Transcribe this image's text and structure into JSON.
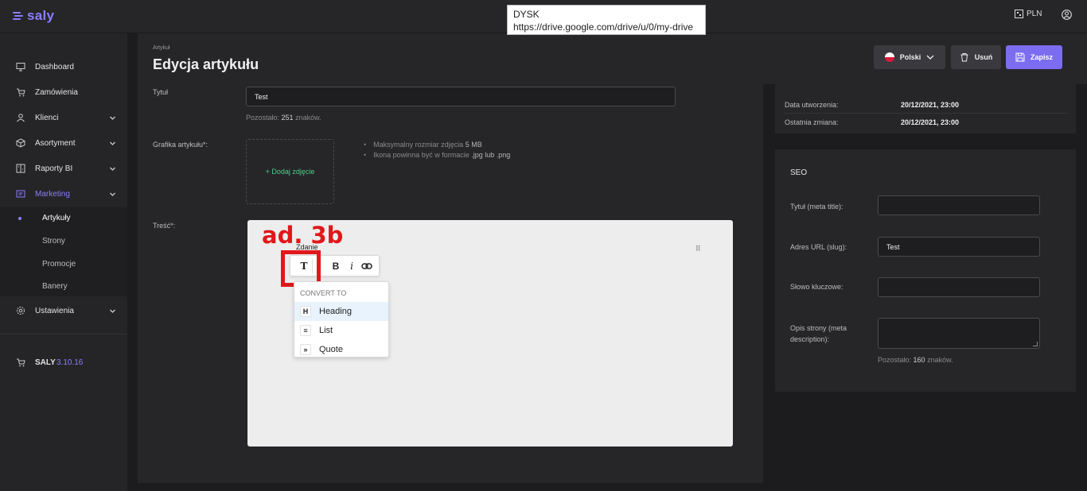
{
  "app": {
    "logo": "saly",
    "brand_color": "#8a7dff"
  },
  "tooltip": {
    "title": "DYSK",
    "url": "https://drive.google.com/drive/u/0/my-drive"
  },
  "topbar": {
    "currency": "PLN"
  },
  "sidebar": {
    "items": [
      {
        "label": "Dashboard",
        "icon": "monitor-icon"
      },
      {
        "label": "Zamówienia",
        "icon": "cart-icon"
      },
      {
        "label": "Klienci",
        "icon": "person-icon"
      },
      {
        "label": "Asortyment",
        "icon": "box-icon"
      },
      {
        "label": "Raporty BI",
        "icon": "report-icon"
      },
      {
        "label": "Marketing",
        "icon": "marketing-icon"
      },
      {
        "label": "Ustawienia",
        "icon": "gear-icon"
      }
    ],
    "sub_items": [
      "Artykuły",
      "Strony",
      "Promocje",
      "Banery"
    ],
    "footer_label": "SALY",
    "version": "3.10.16"
  },
  "header": {
    "breadcrumb": "Artykuł",
    "title": "Edycja artykułu",
    "language": "Polski",
    "delete_label": "Usuń",
    "save_label": "Zapisz"
  },
  "form": {
    "title_label": "Tytuł",
    "title_value": "Test",
    "title_remaining_prefix": "Pozostało:",
    "title_remaining_count": "251",
    "title_remaining_suffix": "znaków.",
    "image_label": "Grafika artykułu*:",
    "add_image": "+ Dodaj zdjęcie",
    "hint_size_prefix": "Maksymalny rozmiar zdjęcia",
    "hint_size_value": "5 MB",
    "hint_format_prefix": "Ikona powinna być w formacie",
    "hint_format_value": ".jpg lub .png",
    "content_label": "Treść*:"
  },
  "editor": {
    "annotation": "ad. 3b",
    "sentence_text": "Zdanie",
    "toolbar": {
      "type_btn": "T",
      "bold_btn": "B",
      "italic_btn": "i"
    },
    "convert_title": "CONVERT TO",
    "convert_options": [
      {
        "icon": "H",
        "label": "Heading"
      },
      {
        "icon": "≡",
        "label": "List"
      },
      {
        "icon": "»",
        "label": "Quote"
      }
    ]
  },
  "info": {
    "created_label": "Data utworzenia:",
    "created_value": "20/12/2021, 23:00",
    "modified_label": "Ostatnia zmiana:",
    "modified_value": "20/12/2021, 23:00"
  },
  "seo": {
    "title": "SEO",
    "meta_title_label": "Tytuł (meta title):",
    "meta_title_value": "",
    "slug_label": "Adres URL (slug):",
    "slug_value": "Test",
    "keyword_label": "Słowo kluczowe:",
    "keyword_value": "",
    "description_label_1": "Opis strony (meta",
    "description_label_2": "description):",
    "remaining_prefix": "Pozostało:",
    "remaining_count": "160",
    "remaining_suffix": "znaków."
  }
}
